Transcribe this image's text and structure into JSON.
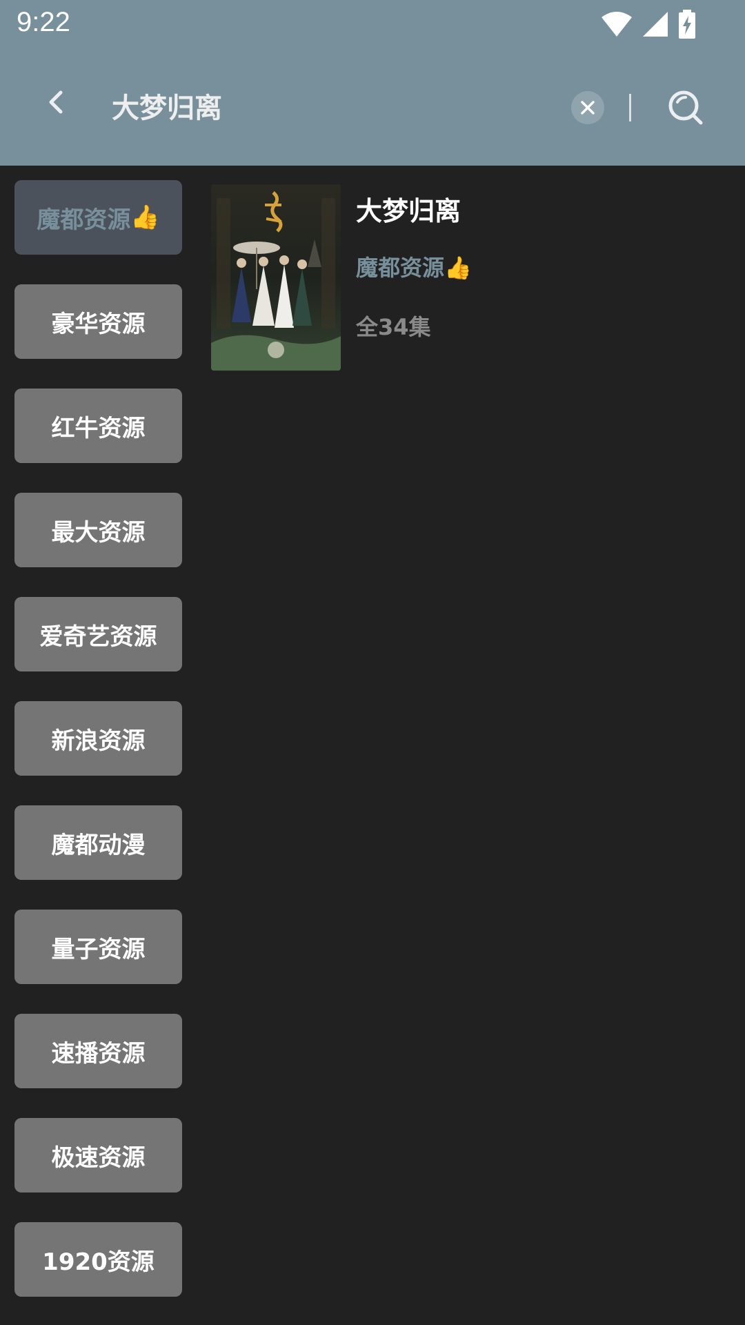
{
  "status_bar": {
    "time": "9:22",
    "icons": [
      "wifi-icon",
      "cell-signal-icon",
      "battery-charging-icon"
    ]
  },
  "toolbar": {
    "search_query": "大梦归离",
    "icons": [
      "back-arrow-icon",
      "clear-icon",
      "search-icon"
    ]
  },
  "sources": [
    {
      "label": "魔都资源",
      "emoji": "👍",
      "active": true
    },
    {
      "label": "豪华资源"
    },
    {
      "label": "红牛资源"
    },
    {
      "label": "最大资源"
    },
    {
      "label": "爱奇艺资源"
    },
    {
      "label": "新浪资源"
    },
    {
      "label": "魔都动漫"
    },
    {
      "label": "量子资源"
    },
    {
      "label": "速播资源"
    },
    {
      "label": "极速资源"
    },
    {
      "label": "1920资源"
    }
  ],
  "result": {
    "title": "大梦归离",
    "source": "魔都资源",
    "source_emoji": "👍",
    "episodes": "全34集"
  },
  "colors": {
    "topbar": "#78909c",
    "background": "#212121",
    "source_button": "#757575",
    "active_source_button": "#4c525b",
    "accent_text": "#78909c"
  }
}
